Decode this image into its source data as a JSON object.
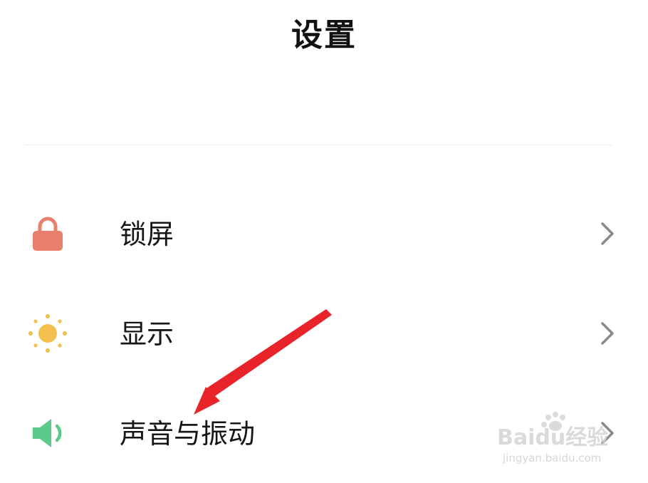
{
  "header": {
    "title": "设置"
  },
  "settings": {
    "items": [
      {
        "label": "锁屏",
        "icon": "lock-icon",
        "icon_color": "#ea7e6c"
      },
      {
        "label": "显示",
        "icon": "sun-icon",
        "icon_color": "#f3c04d"
      },
      {
        "label": "声音与振动",
        "icon": "speaker-icon",
        "icon_color": "#5bc98a"
      }
    ]
  },
  "watermark": {
    "brand_text": "Baidu经验",
    "url_text": "jingyan.baidu.com"
  },
  "colors": {
    "annotation_arrow": "#e8232a",
    "chevron": "#8a8a8a",
    "divider": "#ececec"
  }
}
